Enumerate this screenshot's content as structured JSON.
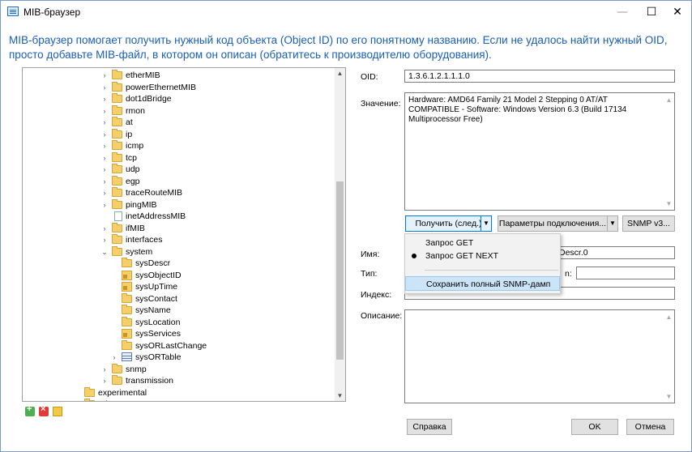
{
  "window": {
    "title": "MIB-браузер",
    "min": "—",
    "max": "☐",
    "close": "✕"
  },
  "intro": "MIB-браузер помогает получить нужный код объекта (Object ID) по его понятному названию. Если не удалось найти нужный OID, просто добавьте MIB-файл, в котором он описан (обратитесь к производителю оборудования).",
  "tree": {
    "items": [
      {
        "label": "etherMIB"
      },
      {
        "label": "powerEthernetMIB"
      },
      {
        "label": "dot1dBridge"
      },
      {
        "label": "rmon"
      },
      {
        "label": "at"
      },
      {
        "label": "ip"
      },
      {
        "label": "icmp"
      },
      {
        "label": "tcp"
      },
      {
        "label": "udp"
      },
      {
        "label": "egp"
      },
      {
        "label": "traceRouteMIB"
      },
      {
        "label": "pingMIB"
      },
      {
        "label": "inetAddressMIB"
      },
      {
        "label": "ifMIB"
      },
      {
        "label": "interfaces"
      },
      {
        "label": "system"
      },
      {
        "label": "sysDescr"
      },
      {
        "label": "sysObjectID"
      },
      {
        "label": "sysUpTime"
      },
      {
        "label": "sysContact"
      },
      {
        "label": "sysName"
      },
      {
        "label": "sysLocation"
      },
      {
        "label": "sysServices"
      },
      {
        "label": "sysORLastChange"
      },
      {
        "label": "sysORTable"
      },
      {
        "label": "snmp"
      },
      {
        "label": "transmission"
      },
      {
        "label": "experimental"
      },
      {
        "label": "private"
      }
    ]
  },
  "form": {
    "oid_label": "OID:",
    "oid_value": "1.3.6.1.2.1.1.1.0",
    "value_label": "Значение:",
    "value_text": "Hardware: AMD64 Family 21 Model 2 Stepping 0 AT/AT COMPATIBLE - Software: Windows Version 6.3 (Build 17134 Multiprocessor Free)",
    "name_label": "Имя:",
    "name_value": "Descr.0",
    "type_label": "Тип:",
    "type_partial_label": "n:",
    "index_label": "Индекс:",
    "description_label": "Описание:"
  },
  "buttons": {
    "get_next": "Получить (след.)",
    "conn_params": "Параметры подключения...",
    "snmp": "SNMP v3...",
    "help": "Справка",
    "ok": "OK",
    "cancel": "Отмена"
  },
  "dropdown": {
    "get": "Запрос GET",
    "get_next": "Запрос GET NEXT",
    "save_dump": "Сохранить полный SNMP-дамп"
  },
  "icons": {
    "chevron_right": "›",
    "chevron_down": "⌄",
    "arrow_up": "▲",
    "arrow_down": "▼",
    "split_down": "▼"
  }
}
